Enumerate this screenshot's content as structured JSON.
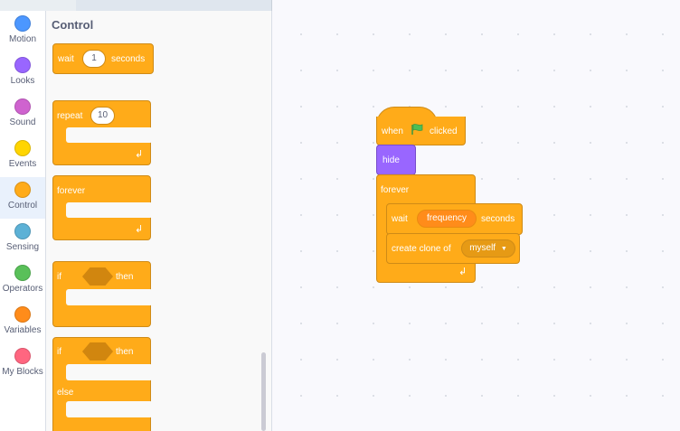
{
  "categories": [
    {
      "label": "Motion",
      "color": "#4c97ff"
    },
    {
      "label": "Looks",
      "color": "#9966ff"
    },
    {
      "label": "Sound",
      "color": "#cf63cf"
    },
    {
      "label": "Events",
      "color": "#ffd500"
    },
    {
      "label": "Control",
      "color": "#ffab19",
      "active": true
    },
    {
      "label": "Sensing",
      "color": "#5cb1d6"
    },
    {
      "label": "Operators",
      "color": "#59c059"
    },
    {
      "label": "Variables",
      "color": "#ff8c1a"
    },
    {
      "label": "My Blocks",
      "color": "#ff6680"
    }
  ],
  "palette": {
    "title": "Control",
    "wait": {
      "label": "wait",
      "value": "1",
      "unit": "seconds"
    },
    "repeat": {
      "label": "repeat",
      "value": "10"
    },
    "forever": {
      "label": "forever"
    },
    "if_then": {
      "if": "if",
      "then": "then"
    },
    "if_else": {
      "if": "if",
      "then": "then",
      "else": "else"
    }
  },
  "script": {
    "hat": {
      "when": "when",
      "clicked": "clicked",
      "icon": "green-flag-icon"
    },
    "hide": "hide",
    "forever": "forever",
    "wait": {
      "label": "wait",
      "reporter": "frequency",
      "unit": "seconds"
    },
    "clone": {
      "label": "create clone of",
      "option": "myself"
    }
  },
  "colors": {
    "control": "#ffab19",
    "looks": "#9966ff",
    "variables": "#ff8c1a",
    "flag": "#4cbf56"
  }
}
